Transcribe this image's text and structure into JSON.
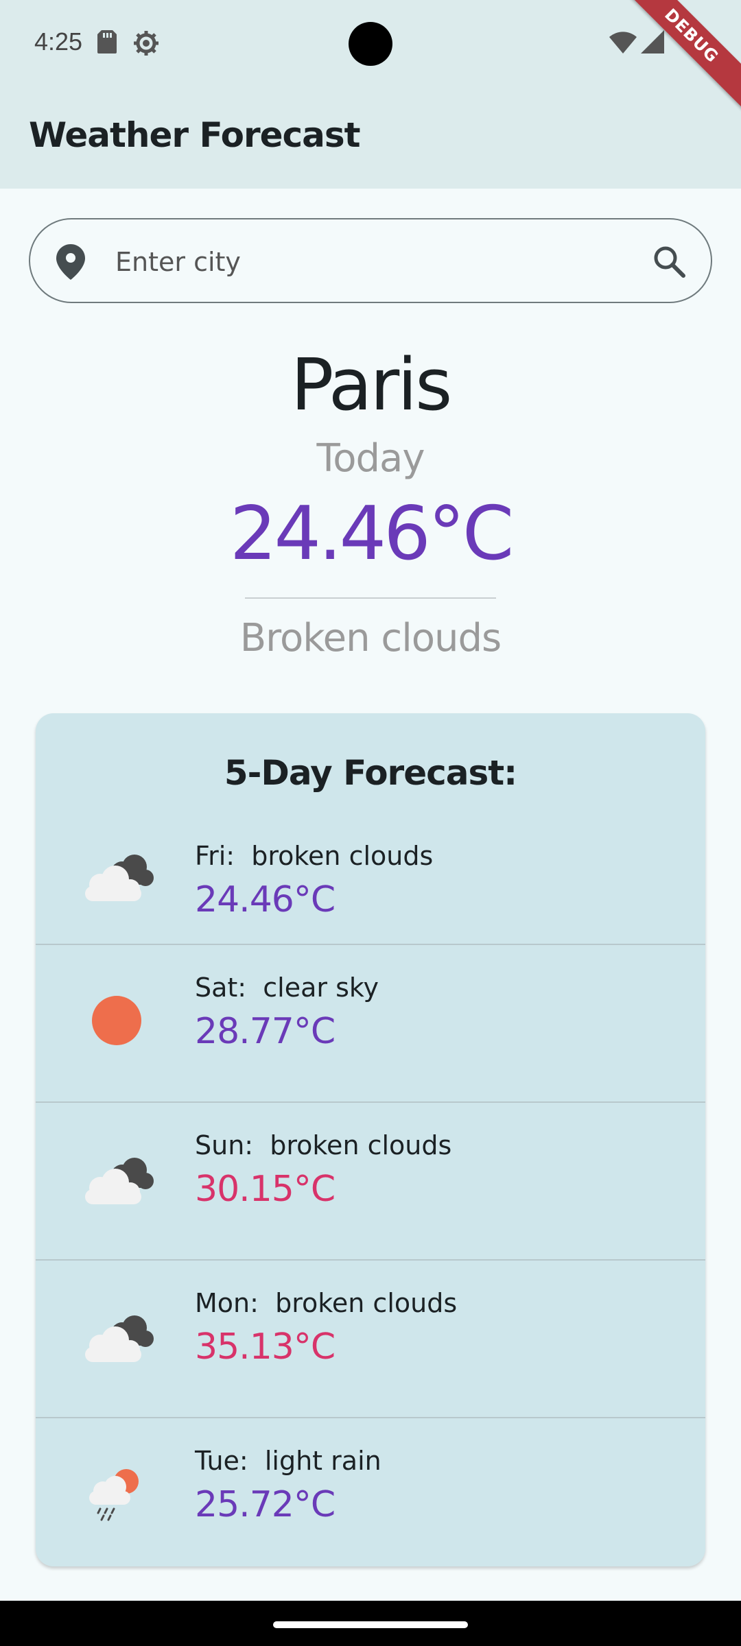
{
  "status_bar": {
    "time": "4:25",
    "icons": [
      "sd-card-icon",
      "settings-gear-icon",
      "wifi-icon",
      "cell-signal-icon"
    ]
  },
  "debug_banner": "DEBUG",
  "app_bar": {
    "title": "Weather Forecast"
  },
  "search": {
    "placeholder": "Enter city",
    "value": "",
    "leading_icon": "location-pin-icon",
    "trailing_icon": "search-icon"
  },
  "current": {
    "city": "Paris",
    "label": "Today",
    "temperature": "24.46°C",
    "description": "Broken clouds"
  },
  "forecast": {
    "title": "5-Day Forecast:",
    "days": [
      {
        "text": "Fri:  broken clouds",
        "temp": "24.46°C",
        "icon": "broken-clouds-icon",
        "temp_color": "#6a3ab8"
      },
      {
        "text": "Sat:  clear sky",
        "temp": "28.77°C",
        "icon": "sun-icon",
        "temp_color": "#6a3ab8"
      },
      {
        "text": "Sun:  broken clouds",
        "temp": "30.15°C",
        "icon": "broken-clouds-icon",
        "temp_color": "#d8336a"
      },
      {
        "text": "Mon:  broken clouds",
        "temp": "35.13°C",
        "icon": "broken-clouds-icon",
        "temp_color": "#d8336a"
      },
      {
        "text": "Tue:  light rain",
        "temp": "25.72°C",
        "icon": "light-rain-icon",
        "temp_color": "#6a3ab8"
      }
    ]
  },
  "colors": {
    "app_bar_bg": "#dcebec",
    "page_bg": "#f4fafb",
    "card_bg": "#cfe6eb",
    "accent_purple": "#6a3ab8",
    "hot_pink": "#d8336a",
    "muted_gray": "#9a9a9a"
  }
}
